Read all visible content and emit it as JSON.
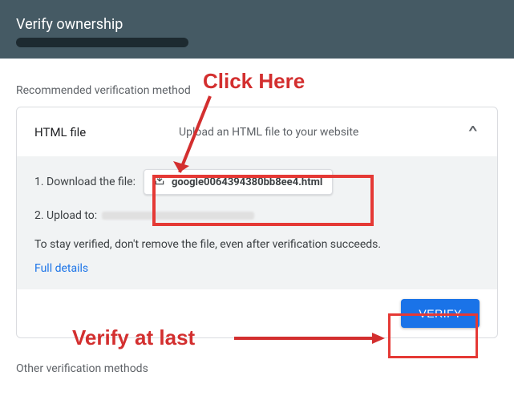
{
  "header": {
    "title": "Verify ownership"
  },
  "recommended_label": "Recommended verification method",
  "other_label": "Other verification methods",
  "method": {
    "name": "HTML file",
    "description": "Upload an HTML file to your website",
    "step1_prefix": "1. Download the file:",
    "download_filename": "google0064394380bb8ee4.html",
    "step2_prefix": "2. Upload to:",
    "note": "To stay verified, don't remove the file, even after verification succeeds.",
    "details_link": "Full details",
    "verify_button": "VERIFY"
  },
  "annotations": {
    "click_here": "Click Here",
    "verify_at_last": "Verify at last"
  }
}
